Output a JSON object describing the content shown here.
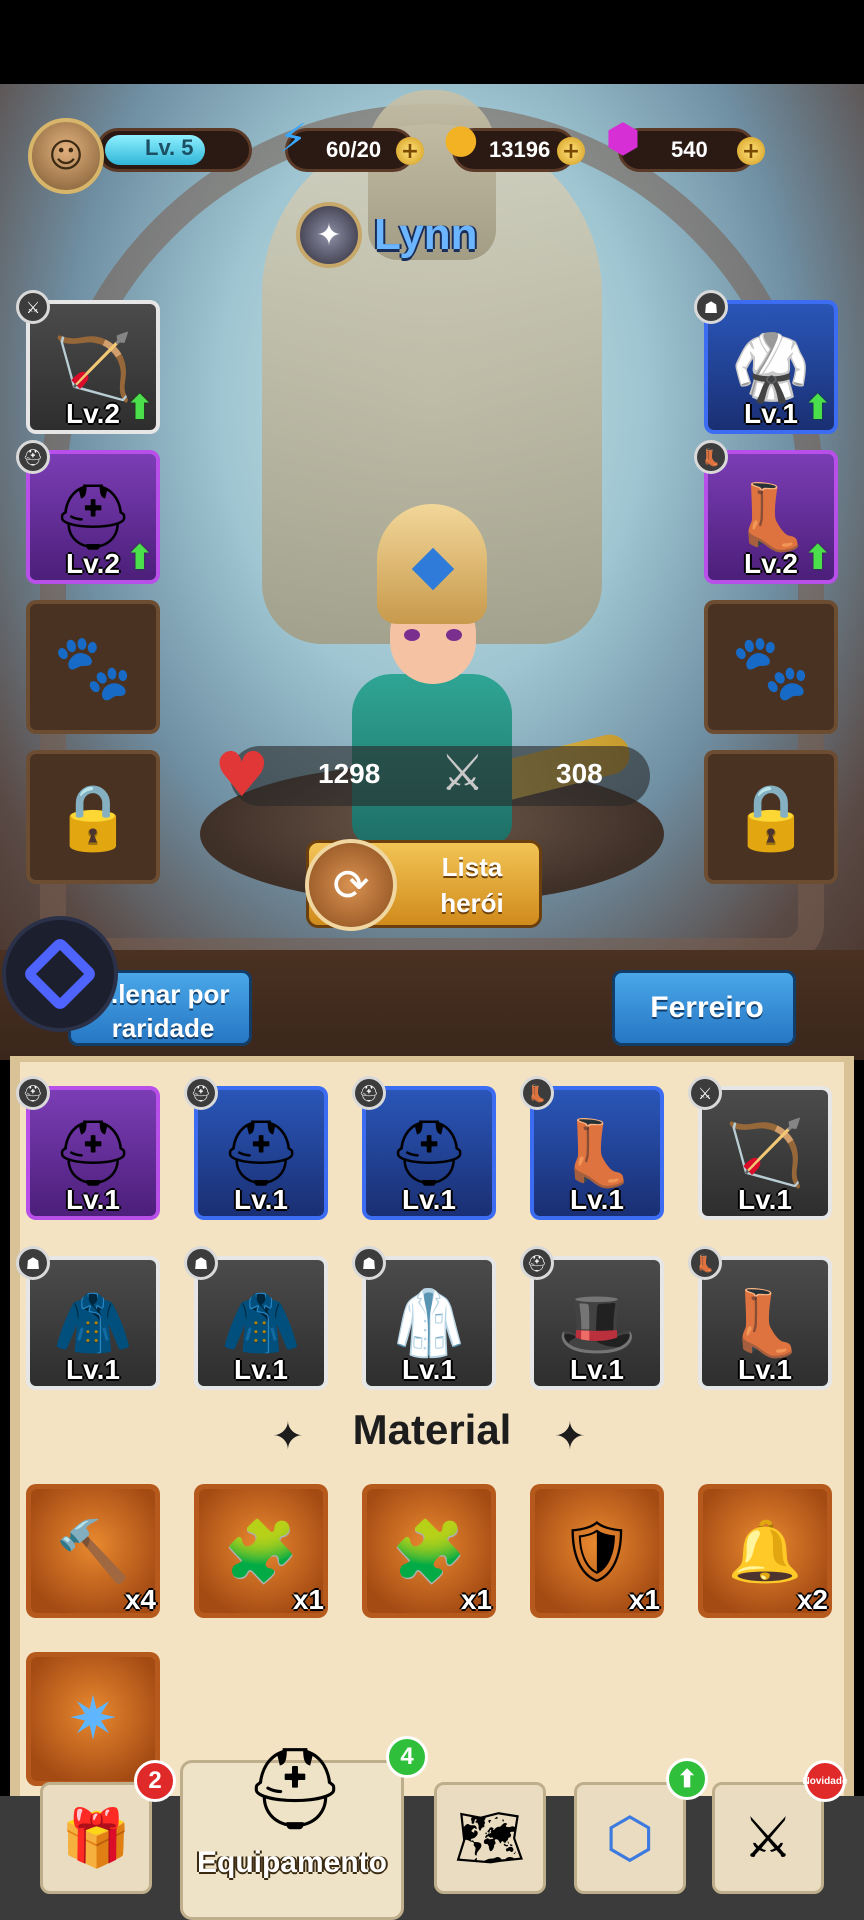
{
  "player": {
    "level_label": "Lv. 5",
    "avatar_icon": "archer-avatar-icon"
  },
  "resources": {
    "energy": {
      "value": "60/20",
      "icon": "lightning-icon"
    },
    "coins": {
      "value": "13196",
      "icon": "crown-coin-icon"
    },
    "gems": {
      "value": "540",
      "icon": "gem-icon"
    }
  },
  "hero": {
    "name": "Lynn",
    "hp": "1298",
    "attack": "308"
  },
  "equipped": {
    "left": [
      {
        "slot": "weapon",
        "level": "Lv.2",
        "upgradable": true,
        "rarity": "white"
      },
      {
        "slot": "helmet",
        "level": "Lv.2",
        "upgradable": true,
        "rarity": "purple"
      }
    ],
    "right": [
      {
        "slot": "armor",
        "level": "Lv.1",
        "upgradable": true,
        "rarity": "blue"
      },
      {
        "slot": "boots",
        "level": "Lv.2",
        "upgradable": true,
        "rarity": "purple"
      }
    ]
  },
  "buttons": {
    "hero_list": "Lista herói",
    "sort": "...lenar por raridade",
    "blacksmith": "Ferreiro"
  },
  "inventory": [
    {
      "level": "Lv.1",
      "rarity": "purple",
      "type": "helmet"
    },
    {
      "level": "Lv.1",
      "rarity": "blue",
      "type": "helmet"
    },
    {
      "level": "Lv.1",
      "rarity": "blue",
      "type": "helmet"
    },
    {
      "level": "Lv.1",
      "rarity": "blue",
      "type": "boots"
    },
    {
      "level": "Lv.1",
      "rarity": "white",
      "type": "weapon"
    },
    {
      "level": "Lv.1",
      "rarity": "white",
      "type": "armor"
    },
    {
      "level": "Lv.1",
      "rarity": "white",
      "type": "armor"
    },
    {
      "level": "Lv.1",
      "rarity": "white",
      "type": "armor"
    },
    {
      "level": "Lv.1",
      "rarity": "white",
      "type": "helmet"
    },
    {
      "level": "Lv.1",
      "rarity": "white",
      "type": "boots"
    }
  ],
  "material": {
    "title": "Material",
    "items": [
      {
        "qty": "x4",
        "icon": "hammer-icon"
      },
      {
        "qty": "x1",
        "icon": "puzzle-icon"
      },
      {
        "qty": "x1",
        "icon": "puzzle-icon"
      },
      {
        "qty": "x1",
        "icon": "shield-crest-icon"
      },
      {
        "qty": "x2",
        "icon": "bell-icon"
      },
      {
        "qty": "",
        "icon": "crystal-icon"
      }
    ]
  },
  "nav": {
    "active_label": "Equipamento",
    "badges": {
      "chest": "2",
      "equipment": "4",
      "new": "Novidade"
    }
  }
}
